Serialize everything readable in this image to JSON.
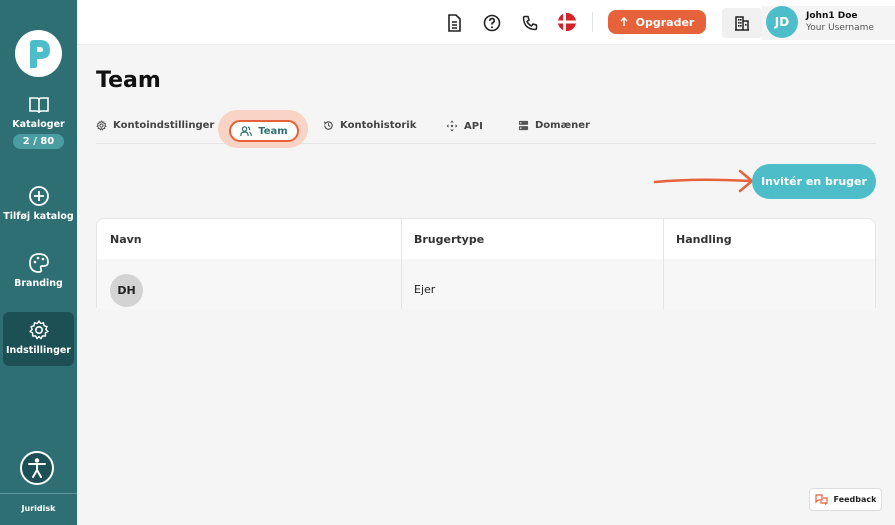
{
  "sidebar": {
    "items": [
      {
        "label": "Kataloger",
        "icon": "book-open-icon",
        "badge": "2 / 80"
      },
      {
        "label": "Tilføj katalog",
        "icon": "plus-circle-icon"
      },
      {
        "label": "Branding",
        "icon": "palette-icon"
      },
      {
        "label": "Indstillinger",
        "icon": "gear-icon"
      }
    ],
    "footer_label": "Juridisk"
  },
  "topbar": {
    "upgrade_label": "Opgrader",
    "user_initials": "JD",
    "user_name": "John1 Doe",
    "user_subtitle": "Your Username"
  },
  "main": {
    "title": "Team",
    "tabs": [
      {
        "label": "Kontoindstillinger",
        "icon": "gear-icon"
      },
      {
        "label": "Team",
        "icon": "users-icon",
        "active": true
      },
      {
        "label": "Kontohistorik",
        "icon": "history-icon"
      },
      {
        "label": "API",
        "icon": "move-icon"
      },
      {
        "label": "Domæner",
        "icon": "server-icon"
      }
    ],
    "invite_label": "Invitér en bruger",
    "table": {
      "columns": [
        "Navn",
        "Brugertype",
        "Handling"
      ],
      "rows": [
        {
          "initials": "DH",
          "type": "Ejer",
          "action": ""
        }
      ]
    }
  },
  "feedback_label": "Feedback",
  "colors": {
    "sidebar": "#2e6f73",
    "accent_orange": "#e5623a",
    "accent_teal": "#4dbdc9"
  }
}
